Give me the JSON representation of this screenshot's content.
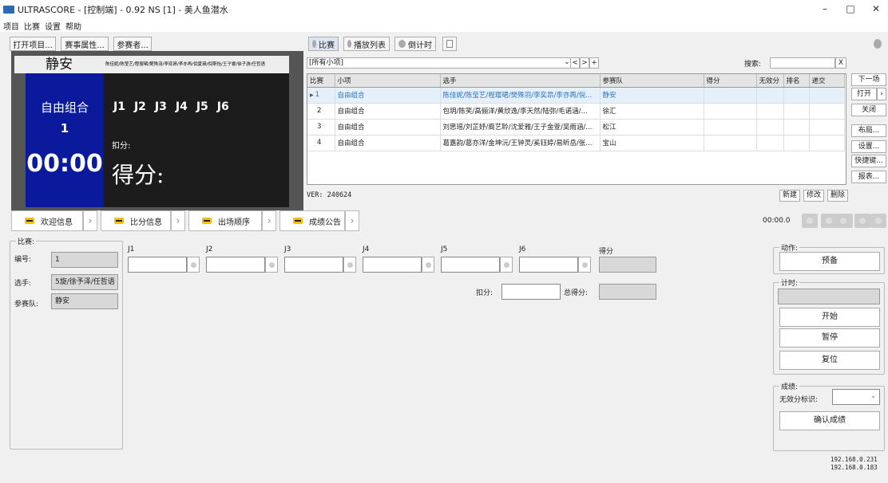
{
  "window": {
    "title": "ULTRASCORE - [控制端] - 0.92 NS [1] - 美人鱼潜水",
    "minimize": "–",
    "maximize": "□",
    "close": "✕"
  },
  "menu": [
    "项目",
    "比赛",
    "设置",
    "帮助"
  ],
  "toolbar": {
    "open_project": "打开项目...",
    "event_props": "赛事属性...",
    "participants": "参赛者..."
  },
  "mid_toolbar": {
    "match": "比赛",
    "playlist": "播放列表",
    "countdown": "倒计时"
  },
  "preview": {
    "venue": "静安",
    "athletes": "陈佳妮/陈莹艺/程璎珺/樊殊羽/李奕昂/李亦再/倪夏瑛/倪斯怡/王子睿/徐子游/任哲语",
    "event": "自由组合",
    "order": "1",
    "judges": [
      "J1",
      "J2",
      "J3",
      "J4",
      "J5",
      "J6"
    ],
    "deduction_label": "扣分:",
    "timer": "00:00",
    "score_label": "得分:"
  },
  "filter": {
    "value": "[所有小项]",
    "dropdown": "⌄",
    "prev": "<",
    "next": ">",
    "add": "+"
  },
  "search": {
    "label": "搜索:",
    "value": "",
    "clear": "X"
  },
  "grid": {
    "columns": [
      "比赛",
      "小项",
      "选手",
      "参赛队",
      "得分",
      "无效分",
      "排名",
      "递交"
    ],
    "rows": [
      {
        "no": "1",
        "event": "自由组合",
        "athletes": "陈佳妮/陈莹艺/程璎珺/樊殊羽/李奕昂/李亦再/倪...",
        "team": "静安",
        "score": "",
        "invalid": "",
        "rank": "",
        "submit": ""
      },
      {
        "no": "2",
        "event": "自由组合",
        "athletes": "包玥/陈笑/高俪洋/黄欣逸/李天然/陆弥/毛诺涵/...",
        "team": "徐汇",
        "score": "",
        "invalid": "",
        "rank": "",
        "submit": ""
      },
      {
        "no": "3",
        "event": "自由组合",
        "athletes": "刘思瑶/刘芷妤/裔艺聆/沈爱雅/王子金萱/吴雨涵/...",
        "team": "松江",
        "score": "",
        "invalid": "",
        "rank": "",
        "submit": ""
      },
      {
        "no": "4",
        "event": "自由组合",
        "athletes": "葛嘉韵/葛亦洋/金坤沅/王钟灵/奚钰婷/易昕岳/张...",
        "team": "宝山",
        "score": "",
        "invalid": "",
        "rank": "",
        "submit": ""
      }
    ]
  },
  "version": "VER: 240624",
  "grid_actions": {
    "new": "新建",
    "edit": "修改",
    "delete": "删除"
  },
  "side_buttons": {
    "next": "下一场",
    "open": "打开",
    "close": "关闭",
    "layout": "布局...",
    "settings": "设置...",
    "shortcuts": "快捷键...",
    "report": "报表..."
  },
  "tabs": [
    "欢迎信息",
    "比分信息",
    "出场顺序",
    "成绩公告"
  ],
  "clock": "00:00.0",
  "match_box": {
    "label": "比赛:",
    "number_label": "编号:",
    "number_value": "1",
    "athlete_label": "选手:",
    "athlete_value": "5旋/徐予泽/任哲语",
    "team_label": "参赛队:",
    "team_value": "静安"
  },
  "judging": {
    "judges": [
      "J1",
      "J2",
      "J3",
      "J4",
      "J5",
      "J6"
    ],
    "score_label": "得分",
    "deduction_label": "扣分:",
    "total_label": "总得分:"
  },
  "action_box": {
    "label": "动作:",
    "prepare": "预备"
  },
  "timing_box": {
    "label": "计时:",
    "start": "开始",
    "pause": "暂停",
    "reset": "复位"
  },
  "result_box": {
    "label": "成绩:",
    "invalid_label": "无效分标识:",
    "confirm": "确认成绩"
  },
  "ips": [
    "192.168.0.231",
    "192.168.0.183"
  ]
}
